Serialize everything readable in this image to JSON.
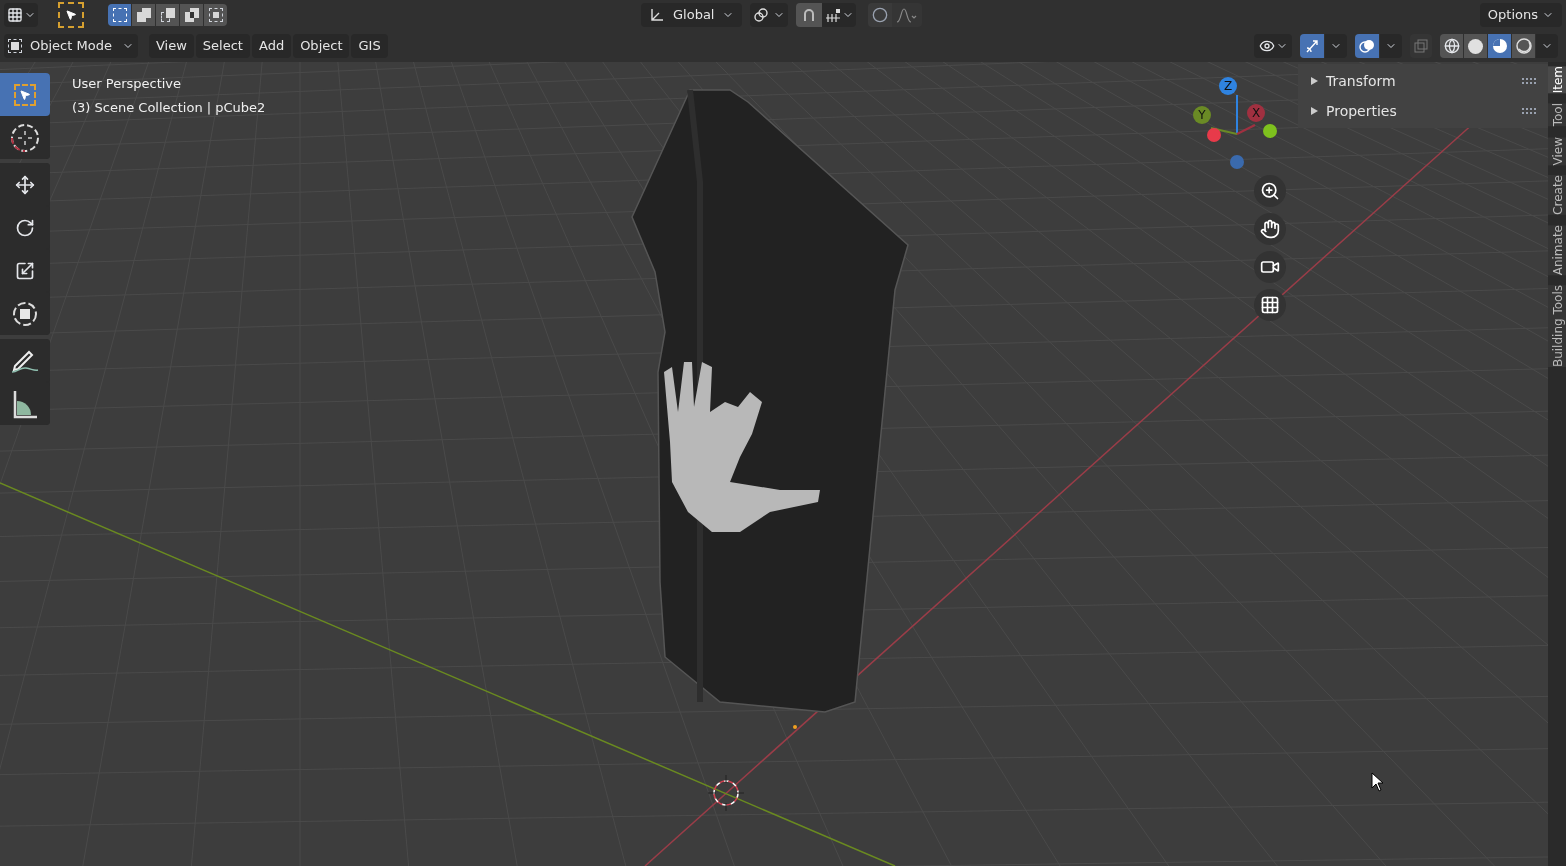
{
  "header": {
    "select_modes": [
      {
        "selected": true
      },
      {
        "selected": false
      },
      {
        "selected": false
      },
      {
        "selected": false
      },
      {
        "selected": false
      }
    ],
    "orientation": "Global",
    "snap_on": true,
    "proportional_on": false,
    "options": "Options"
  },
  "menu_bar": {
    "mode": "Object Mode",
    "menus": [
      "View",
      "Select",
      "Add",
      "Object",
      "GIS"
    ],
    "gizmo_toggle_on": true,
    "overlay_toggle_on": true,
    "xray_on": false,
    "shading": [
      {
        "kind": "wireframe",
        "selected": false
      },
      {
        "kind": "solid",
        "selected": false
      },
      {
        "kind": "material",
        "selected": true
      },
      {
        "kind": "rendered",
        "selected": false
      }
    ]
  },
  "viewport": {
    "view_name": "User Perspective",
    "collection": "(3) Scene Collection | pCube2",
    "tools": [
      {
        "kind": "select",
        "selected": true
      },
      {
        "kind": "cursor",
        "selected": false
      },
      {
        "kind": "move",
        "selected": false
      },
      {
        "kind": "rotate",
        "selected": false
      },
      {
        "kind": "scale",
        "selected": false
      },
      {
        "kind": "transform",
        "selected": false
      },
      {
        "kind": "annotate",
        "selected": false
      },
      {
        "kind": "measure",
        "selected": false
      }
    ],
    "axes": [
      {
        "kind": "z",
        "label": "Z"
      },
      {
        "kind": "y",
        "label": "Y"
      },
      {
        "kind": "x",
        "label": "X"
      }
    ]
  },
  "sidebar": {
    "panels": [
      {
        "label": "Transform",
        "expanded": false
      },
      {
        "label": "Properties",
        "expanded": false
      }
    ],
    "tabs": [
      {
        "label": "Item",
        "selected": true
      },
      {
        "label": "Tool",
        "selected": false
      },
      {
        "label": "View",
        "selected": false
      },
      {
        "label": "Create",
        "selected": false
      },
      {
        "label": "Animate",
        "selected": false
      },
      {
        "label": "Building Tools",
        "selected": false
      }
    ]
  }
}
